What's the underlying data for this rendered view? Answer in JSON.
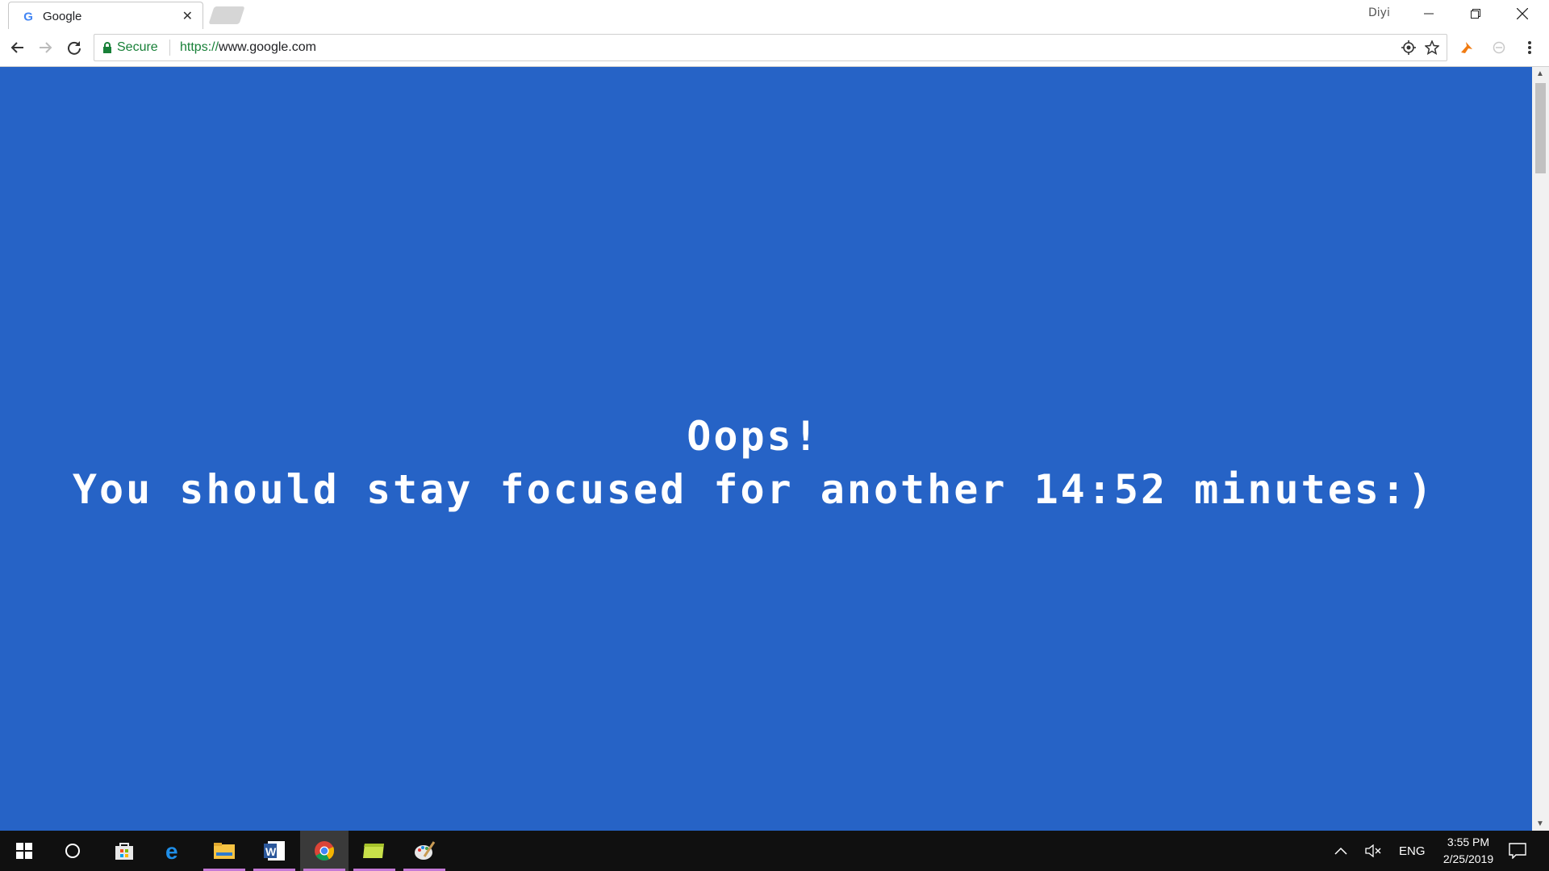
{
  "browser": {
    "tab_title": "Google",
    "profile_name": "Diyi",
    "secure_label": "Secure",
    "url_scheme": "https://",
    "url_host": "www.google.com"
  },
  "page": {
    "heading": "Oops!",
    "message": "You should stay focused for another 14:52 minutes:)",
    "background_color": "#2663c6"
  },
  "taskbar": {
    "apps": [
      "start-icon",
      "cortana-icon",
      "store-icon",
      "edge-icon",
      "file-explorer-icon",
      "word-icon",
      "chrome-icon",
      "sticky-notes-icon",
      "paint-icon"
    ],
    "language": "ENG",
    "time": "3:55 PM",
    "date": "2/25/2019"
  }
}
